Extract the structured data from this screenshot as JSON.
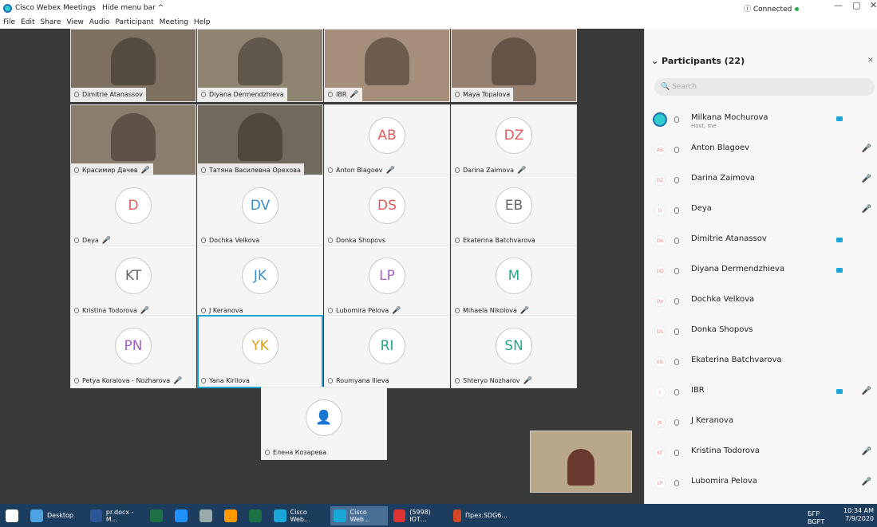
{
  "window": {
    "title": "Cisco Webex Meetings",
    "hide_menu": "Hide menu bar ^",
    "status": "Connected",
    "controls": [
      "—",
      "▢",
      "✕"
    ]
  },
  "menu": [
    "File",
    "Edit",
    "Share",
    "View",
    "Audio",
    "Participant",
    "Meeting",
    "Help"
  ],
  "tiles": [
    {
      "name": "Dimitrie Atanassov",
      "type": "video"
    },
    {
      "name": "Diyana Dermendzhieva",
      "type": "video"
    },
    {
      "name": "IBR",
      "type": "video",
      "muted": true
    },
    {
      "name": "Maya Topalova",
      "type": "video"
    },
    {
      "name": "Красимир Дачев",
      "type": "video",
      "muted": true
    },
    {
      "name": "Татяна Василевна Орехова",
      "type": "video"
    },
    {
      "name": "Anton Blagoev",
      "type": "avatar",
      "initials": "AB",
      "color": "#e35b5b",
      "muted": true
    },
    {
      "name": "Darina Zaimova",
      "type": "avatar",
      "initials": "DZ",
      "color": "#e35b5b",
      "muted": true
    },
    {
      "name": "Deya",
      "type": "avatar",
      "initials": "D",
      "color": "#e35b5b",
      "muted": true
    },
    {
      "name": "Dochka Velkova",
      "type": "avatar",
      "initials": "DV",
      "color": "#3a8fd0"
    },
    {
      "name": "Donka Shopovs",
      "type": "avatar",
      "initials": "DS",
      "color": "#e35b5b"
    },
    {
      "name": "Ekaterina Batchvarova",
      "type": "avatar",
      "initials": "EB",
      "color": "#666"
    },
    {
      "name": "Kristina Todorova",
      "type": "avatar",
      "initials": "KT",
      "color": "#666",
      "muted": true
    },
    {
      "name": "J Keranova",
      "type": "avatar",
      "initials": "JK",
      "color": "#3a8fd0"
    },
    {
      "name": "Lubomira Pelova",
      "type": "avatar",
      "initials": "LP",
      "color": "#a65fc6",
      "muted": true
    },
    {
      "name": "Mihaela Nikolova",
      "type": "avatar",
      "initials": "M",
      "color": "#2aa88a",
      "muted": true
    },
    {
      "name": "Petya Koralova - Nozharova",
      "type": "avatar",
      "initials": "PN",
      "color": "#a65fc6",
      "muted": true
    },
    {
      "name": "Yana Kirilova",
      "type": "avatar",
      "initials": "YK",
      "color": "#e0a020",
      "selected": true
    },
    {
      "name": "Roumyana Ilieva",
      "type": "avatar",
      "initials": "RI",
      "color": "#2aa88a"
    },
    {
      "name": "Shteryo Nozharov",
      "type": "avatar",
      "initials": "SN",
      "color": "#2aa88a",
      "muted": true
    },
    {
      "name": "Елена Козарева",
      "type": "avatar",
      "initials": "",
      "color": "#999"
    }
  ],
  "panel": {
    "title": "Participants (22)",
    "search_placeholder": "Search",
    "rows": [
      {
        "initials": "",
        "name": "Milkana Mochurova",
        "sub": "Host, me",
        "cam": true,
        "muted": false
      },
      {
        "initials": "AB",
        "name": "Anton Blagoev",
        "cam": false,
        "muted": true
      },
      {
        "initials": "DZ",
        "name": "Darina Zaimova",
        "cam": false,
        "muted": true
      },
      {
        "initials": "D",
        "name": "Deya",
        "cam": false,
        "muted": true
      },
      {
        "initials": "DA",
        "name": "Dimitrie Atanassov",
        "cam": true,
        "muted": false
      },
      {
        "initials": "DD",
        "name": "Diyana Dermendzhieva",
        "cam": true,
        "muted": false
      },
      {
        "initials": "DV",
        "name": "Dochka Velkova",
        "cam": false,
        "muted": false
      },
      {
        "initials": "DS",
        "name": "Donka Shopovs",
        "cam": false,
        "muted": false
      },
      {
        "initials": "EB",
        "name": "Ekaterina Batchvarova",
        "cam": false,
        "muted": false
      },
      {
        "initials": "I",
        "name": "IBR",
        "cam": true,
        "muted": true
      },
      {
        "initials": "JK",
        "name": "J Keranova",
        "cam": false,
        "muted": false
      },
      {
        "initials": "KT",
        "name": "Kristina Todorova",
        "cam": false,
        "muted": true
      },
      {
        "initials": "LP",
        "name": "Lubomira Pelova",
        "cam": false,
        "muted": true
      }
    ]
  },
  "taskbar": {
    "items": [
      {
        "label": "",
        "color": "#fff"
      },
      {
        "label": "Desktop",
        "color": "#4da3e0"
      },
      {
        "label": "pr.docx - M...",
        "color": "#2b5797"
      },
      {
        "label": "",
        "color": "#1e7145"
      },
      {
        "label": "",
        "color": "#1e90ff"
      },
      {
        "label": "",
        "color": "#9aa"
      },
      {
        "label": "",
        "color": "#ff9900"
      },
      {
        "label": "",
        "color": "#1e7145"
      },
      {
        "label": "Cisco Web...",
        "color": "#1aa7d8"
      },
      {
        "label": "Cisco Web...",
        "color": "#1aa7d8",
        "active": true
      },
      {
        "label": "(5998) ЮТ...",
        "color": "#d33"
      },
      {
        "label": "През.SDG6...",
        "color": "#d24726"
      }
    ],
    "tray": "БГР\nBGPT",
    "time": "10:34 AM",
    "date": "7/9/2020"
  }
}
